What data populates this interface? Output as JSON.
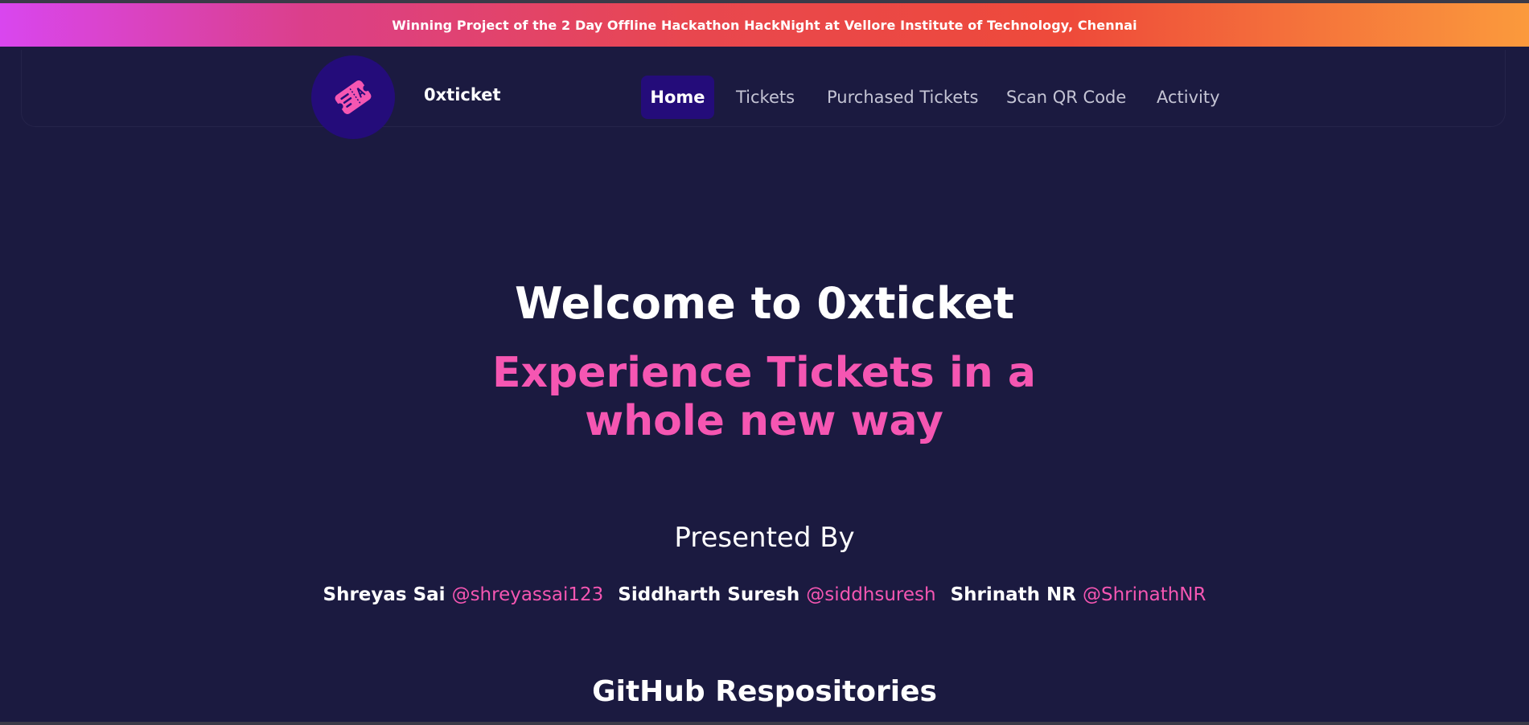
{
  "banner": {
    "text": "Winning Project of the 2 Day Offline Hackathon HackNight at Vellore Institute of Technology, Chennai"
  },
  "navbar": {
    "logo_icon": "ticket-icon",
    "brand": "0xticket",
    "items": [
      {
        "label": "Home",
        "active": true
      },
      {
        "label": "Tickets",
        "active": false
      },
      {
        "label": "Purchased Tickets",
        "active": false
      },
      {
        "label": "Scan QR Code",
        "active": false
      },
      {
        "label": "Activity",
        "active": false
      }
    ]
  },
  "hero": {
    "title": "Welcome to 0xticket",
    "subtitle": "Experience Tickets in a whole new way"
  },
  "presented": {
    "heading": "Presented By",
    "people": [
      {
        "name": "Shreyas Sai",
        "handle": "@shreyassai123"
      },
      {
        "name": "Siddharth Suresh",
        "handle": "@siddhsuresh"
      },
      {
        "name": "Shrinath NR",
        "handle": "@ShrinathNR"
      }
    ]
  },
  "github": {
    "heading": "GitHub Respositories"
  },
  "colors": {
    "background": "#1b1a40",
    "accent_pink": "#f556b2",
    "nav_active_bg": "#240c7a",
    "banner_gradient_start": "#d946ef",
    "banner_gradient_end": "#fb9a3c"
  }
}
